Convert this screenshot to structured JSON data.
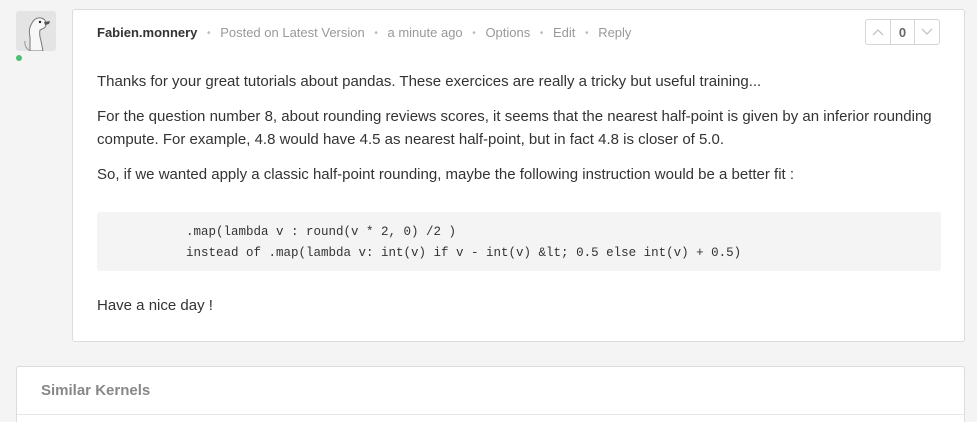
{
  "comment": {
    "author": "Fabien.monnery",
    "posted_on": "Posted on Latest Version",
    "time_ago": "a minute ago",
    "actions": {
      "options": "Options",
      "edit": "Edit",
      "reply": "Reply"
    },
    "vote_count": "0",
    "paragraphs": [
      "Thanks for your great tutorials about pandas. These exercices are really a tricky but useful training...",
      "For the question number 8, about rounding reviews scores, it seems that the nearest half-point is given by an inferior rounding compute. For example, 4.8 would have 4.5 as nearest half-point, but in fact 4.8 is closer of 5.0.",
      "So, if we wanted apply a classic half-point rounding, maybe the following instruction would be a better fit :"
    ],
    "code_lines": [
      ".map(lambda v : round(v * 2, 0) /2 )",
      "instead of .map(lambda v: int(v) if v - int(v) &lt; 0.5 else int(v) + 0.5)"
    ],
    "closing": "Have a nice day !"
  },
  "similar_kernels": {
    "title": "Similar Kernels"
  },
  "icons": {
    "avatar": "goose-avatar-icon",
    "upvote": "chevron-up-icon",
    "downvote": "chevron-down-icon"
  },
  "colors": {
    "online_status": "#4bbf73"
  }
}
